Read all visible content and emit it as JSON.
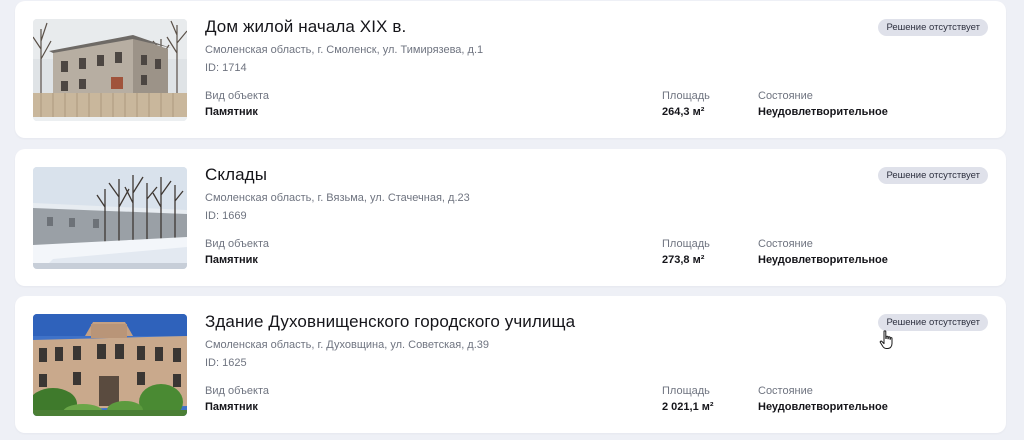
{
  "common": {
    "badge": "Решение отсутствует",
    "type_label": "Вид объекта",
    "area_label": "Площадь",
    "state_label": "Состояние"
  },
  "objects": [
    {
      "title": "Дом жилой начала XIX в.",
      "address": "Смоленская область, г. Смоленск, ул. Тимирязева, д.1",
      "id_text": "ID: 1714",
      "type_value": "Памятник",
      "area_value": "264,3 м²",
      "state_value": "Неудовлетворительное"
    },
    {
      "title": "Склады",
      "address": "Смоленская область, г. Вязьма, ул. Стачечная, д.23",
      "id_text": "ID: 1669",
      "type_value": "Памятник",
      "area_value": "273,8 м²",
      "state_value": "Неудовлетворительное"
    },
    {
      "title": "Здание Духовнищенского городского училища",
      "address": "Смоленская область, г. Духовщина, ул. Советская, д.39",
      "id_text": "ID: 1625",
      "type_value": "Памятник",
      "area_value": "2 021,1 м²",
      "state_value": "Неудовлетворительное"
    }
  ],
  "colors": {
    "page_bg": "#eef0f6",
    "card_bg": "#ffffff",
    "badge_bg": "#dfe1ea",
    "muted_text": "#6f7480"
  }
}
